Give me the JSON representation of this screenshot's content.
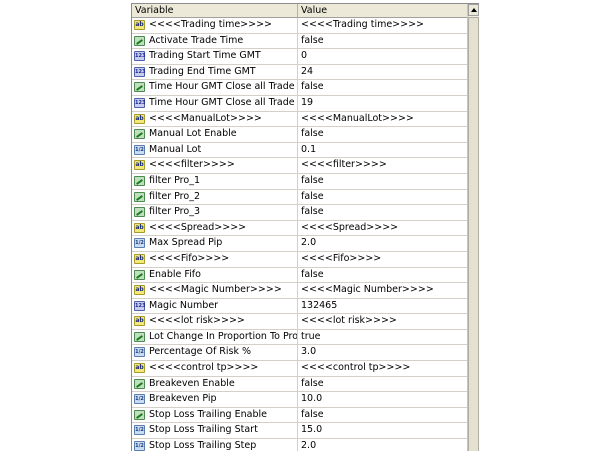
{
  "header": {
    "variable": "Variable",
    "value": "Value"
  },
  "rows": [
    {
      "icon": "ab-icon",
      "name": "<<<<Trading time>>>>",
      "value": "<<<<Trading time>>>>"
    },
    {
      "icon": "bool-icon",
      "name": "Activate Trade Time",
      "value": "false"
    },
    {
      "icon": "int-icon",
      "name": "Trading Start Time GMT",
      "value": "0"
    },
    {
      "icon": "int-icon",
      "name": "Trading End Time GMT",
      "value": "24"
    },
    {
      "icon": "bool-icon",
      "name": "Time Hour GMT Close all Trade On Frid...",
      "value": "false"
    },
    {
      "icon": "int-icon",
      "name": "Time Hour GMT Close all Trade On Fri...",
      "value": "19"
    },
    {
      "icon": "ab-icon",
      "name": "<<<<ManualLot>>>>",
      "value": "<<<<ManualLot>>>>"
    },
    {
      "icon": "bool-icon",
      "name": "Manual Lot Enable",
      "value": "false"
    },
    {
      "icon": "double-icon",
      "name": "Manual Lot",
      "value": "0.1"
    },
    {
      "icon": "ab-icon",
      "name": "<<<<filter>>>>",
      "value": "<<<<filter>>>>"
    },
    {
      "icon": "bool-icon",
      "name": "filter Pro_1",
      "value": "false"
    },
    {
      "icon": "bool-icon",
      "name": "filter Pro_2",
      "value": "false"
    },
    {
      "icon": "bool-icon",
      "name": "filter Pro_3",
      "value": "false"
    },
    {
      "icon": "ab-icon",
      "name": "<<<<Spread>>>>",
      "value": "<<<<Spread>>>>"
    },
    {
      "icon": "double-icon",
      "name": "Max Spread Pip",
      "value": "2.0"
    },
    {
      "icon": "ab-icon",
      "name": "<<<<Fifo>>>>",
      "value": "<<<<Fifo>>>>"
    },
    {
      "icon": "bool-icon",
      "name": "Enable Fifo",
      "value": "false"
    },
    {
      "icon": "ab-icon",
      "name": "<<<<Magic Number>>>>",
      "value": "<<<<Magic Number>>>>"
    },
    {
      "icon": "int-icon",
      "name": "Magic Number",
      "value": "132465"
    },
    {
      "icon": "ab-icon",
      "name": "<<<<lot risk>>>>",
      "value": "<<<<lot risk>>>>"
    },
    {
      "icon": "bool-icon",
      "name": "Lot Change In Proportion To Profit",
      "value": "true"
    },
    {
      "icon": "double-icon",
      "name": "Percentage Of Risk  %",
      "value": "3.0"
    },
    {
      "icon": "ab-icon",
      "name": "<<<<control tp>>>>",
      "value": "<<<<control tp>>>>"
    },
    {
      "icon": "bool-icon",
      "name": "Breakeven Enable",
      "value": "false"
    },
    {
      "icon": "double-icon",
      "name": "Breakeven Pip",
      "value": "10.0"
    },
    {
      "icon": "bool-icon",
      "name": "Stop Loss Trailing Enable",
      "value": "false"
    },
    {
      "icon": "double-icon",
      "name": "Stop Loss Trailing Start",
      "value": "15.0"
    },
    {
      "icon": "double-icon",
      "name": "Stop Loss Trailing Step",
      "value": "2.0"
    }
  ],
  "icons": {
    "ab-icon": "ab",
    "int-icon": "123",
    "double-icon": "1/2"
  }
}
